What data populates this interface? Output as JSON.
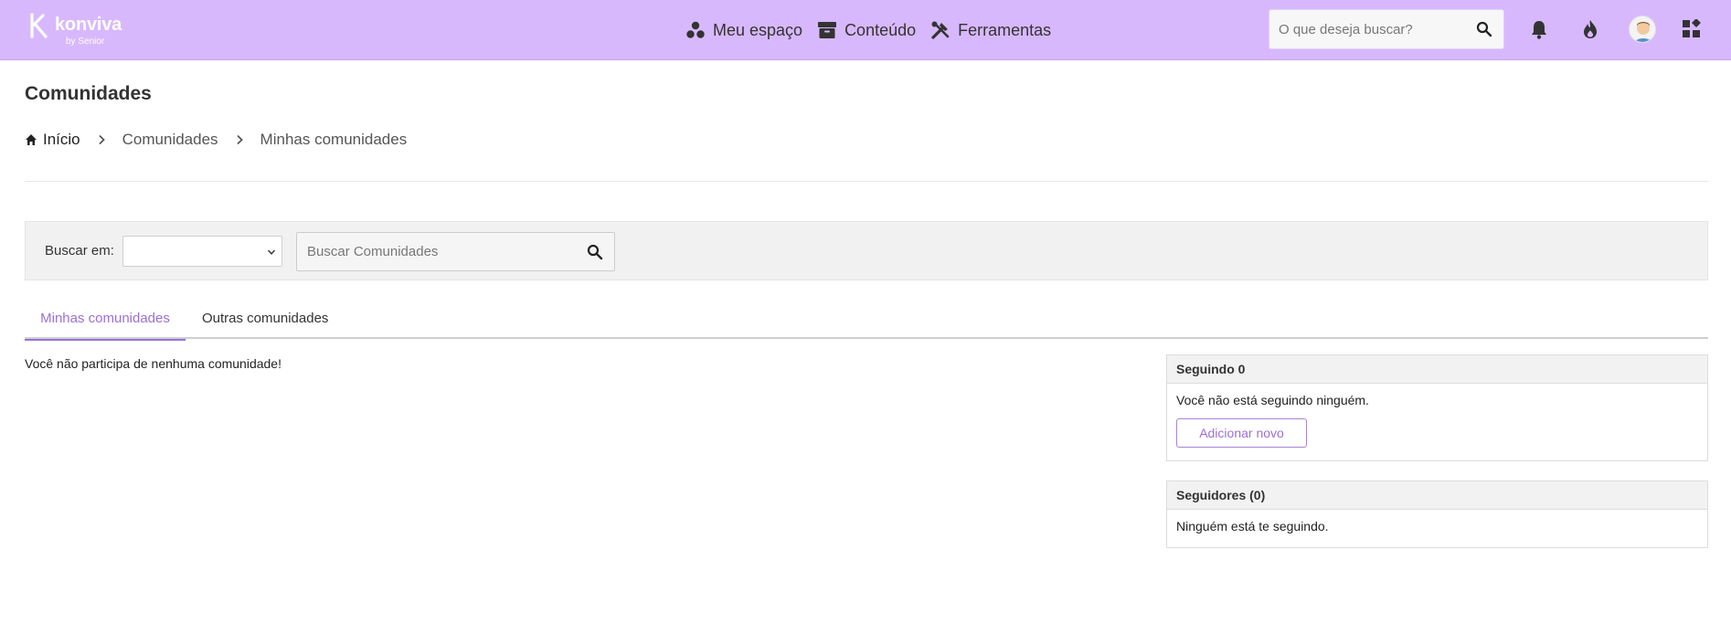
{
  "header": {
    "logo_text": "konviva",
    "logo_sub": "by Senior",
    "nav": [
      {
        "label": "Meu espaço",
        "icon": "dots-icon"
      },
      {
        "label": "Conteúdo",
        "icon": "archive-icon"
      },
      {
        "label": "Ferramentas",
        "icon": "tools-icon"
      }
    ],
    "search_placeholder": "O que deseja buscar?",
    "icons": [
      "bell-icon",
      "fire-icon",
      "avatar",
      "apps-grid-icon"
    ],
    "accent_color": "#d8b8fc"
  },
  "page": {
    "title": "Comunidades",
    "breadcrumb": [
      "Início",
      "Comunidades",
      "Minhas comunidades"
    ]
  },
  "filter": {
    "label": "Buscar em:",
    "select_value": "",
    "search_placeholder": "Buscar Comunidades"
  },
  "tabs": [
    {
      "label": "Minhas comunidades",
      "active": true
    },
    {
      "label": "Outras comunidades",
      "active": false
    }
  ],
  "content": {
    "empty_message": "Você não participa de nenhuma comunidade!"
  },
  "following": {
    "title": "Seguindo 0",
    "message": "Você não está seguindo ninguém.",
    "button": "Adicionar novo"
  },
  "followers": {
    "title": "Seguidores (0)",
    "message": "Ninguém está te seguindo."
  },
  "colors": {
    "tab_active": "#9b6fd8",
    "filter_bg": "#f1f1f1"
  }
}
